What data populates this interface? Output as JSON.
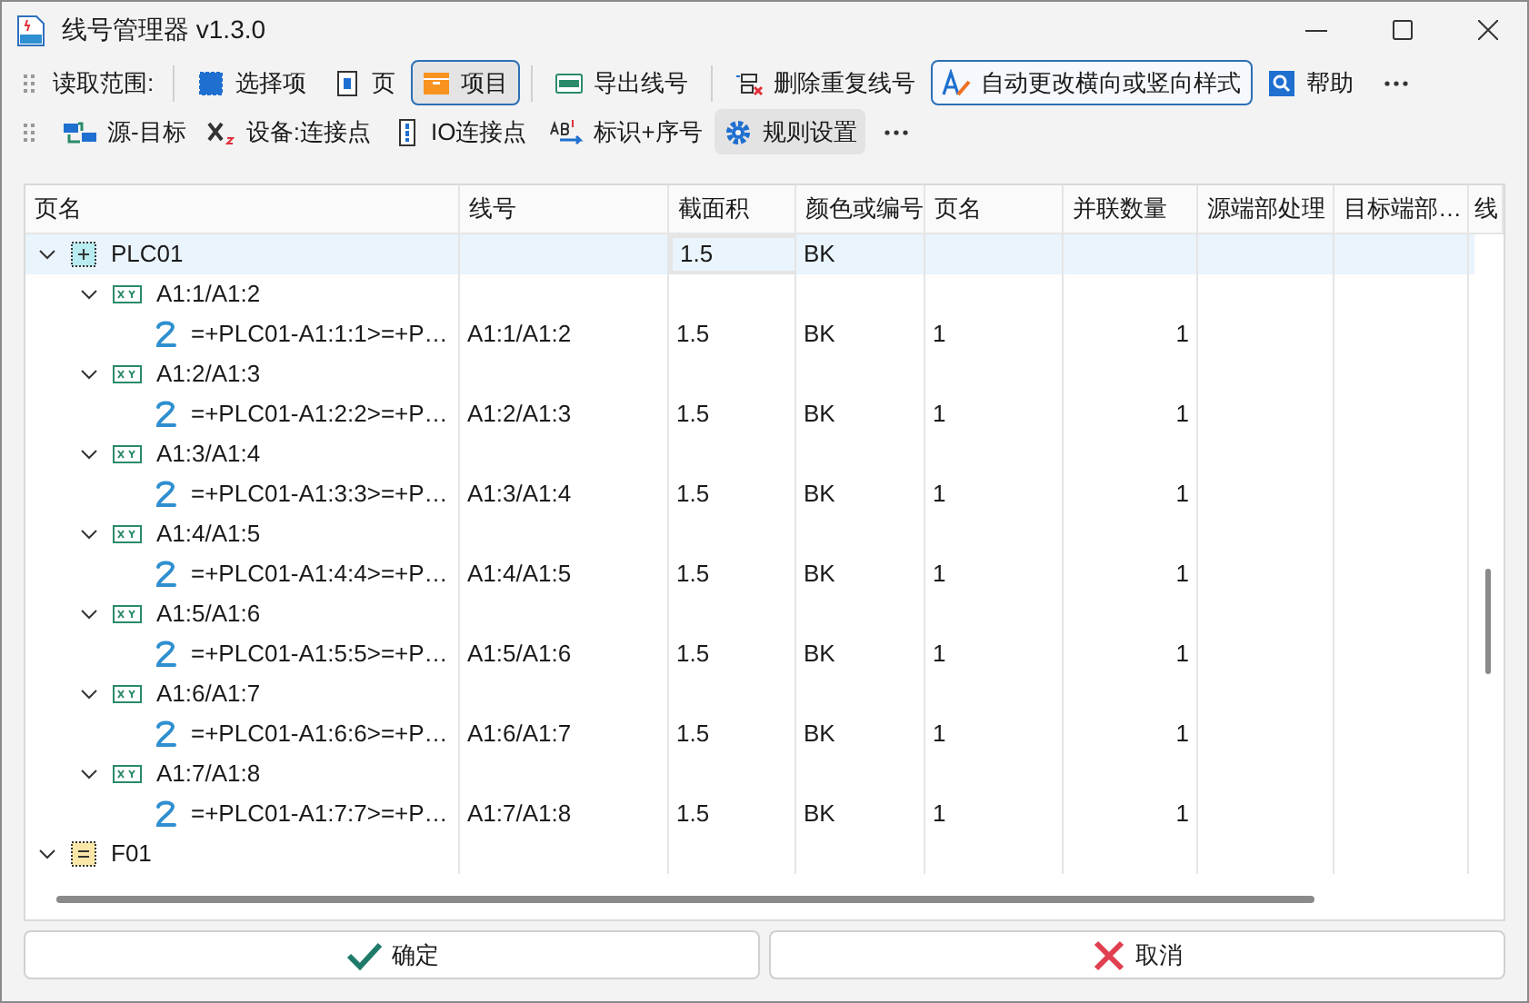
{
  "window": {
    "title": "线号管理器 v1.3.0"
  },
  "toolbar_1": {
    "scope_label": "读取范围:",
    "scope_options": [
      {
        "label": "选择项",
        "kind": "selection",
        "selected": false
      },
      {
        "label": "页",
        "kind": "page",
        "selected": false
      },
      {
        "label": "项目",
        "kind": "project",
        "selected": true
      }
    ],
    "actions": [
      {
        "label": "导出线号",
        "kind": "export",
        "checked": false,
        "divider_before": true
      },
      {
        "label": "删除重复线号",
        "kind": "dedupe",
        "checked": false,
        "divider_before": true
      },
      {
        "label": "自动更改横向或竖向样式",
        "kind": "orientation",
        "checked": true,
        "divider_before": false
      },
      {
        "label": "帮助",
        "kind": "help",
        "checked": false,
        "divider_before": false
      }
    ]
  },
  "toolbar_2": {
    "actions": [
      {
        "label": "源-目标",
        "kind": "source_target",
        "highlighted": false
      },
      {
        "label": "设备:连接点",
        "kind": "device_point",
        "highlighted": false
      },
      {
        "label": "IO连接点",
        "kind": "io_point",
        "highlighted": false
      },
      {
        "label": "标识+序号",
        "kind": "tag_index",
        "highlighted": false
      },
      {
        "label": "规则设置",
        "kind": "settings",
        "highlighted": true
      }
    ]
  },
  "table": {
    "columns": [
      "页名",
      "线号",
      "截面积",
      "颜色或编号",
      "页名",
      "并联数量",
      "源端部处理",
      "目标端部…",
      "线"
    ],
    "rows": [
      {
        "kind": "location",
        "label": "PLC01",
        "expanded": true,
        "selected": true,
        "cross_section_focused": true,
        "cross_section": "1.5",
        "color_code": "BK",
        "children": [
          {
            "kind": "pair",
            "label": "A1:1/A1:2",
            "expanded": true,
            "children": [
              {
                "kind": "wire",
                "label": "=+PLC01-A1:1:1>=+P…",
                "wire_no": "A1:1/A1:2",
                "cross_section": "1.5",
                "color_code": "BK",
                "page": "1",
                "parallel_count": "1"
              }
            ]
          },
          {
            "kind": "pair",
            "label": "A1:2/A1:3",
            "expanded": true,
            "children": [
              {
                "kind": "wire",
                "label": "=+PLC01-A1:2:2>=+P…",
                "wire_no": "A1:2/A1:3",
                "cross_section": "1.5",
                "color_code": "BK",
                "page": "1",
                "parallel_count": "1"
              }
            ]
          },
          {
            "kind": "pair",
            "label": "A1:3/A1:4",
            "expanded": true,
            "children": [
              {
                "kind": "wire",
                "label": "=+PLC01-A1:3:3>=+P…",
                "wire_no": "A1:3/A1:4",
                "cross_section": "1.5",
                "color_code": "BK",
                "page": "1",
                "parallel_count": "1"
              }
            ]
          },
          {
            "kind": "pair",
            "label": "A1:4/A1:5",
            "expanded": true,
            "children": [
              {
                "kind": "wire",
                "label": "=+PLC01-A1:4:4>=+P…",
                "wire_no": "A1:4/A1:5",
                "cross_section": "1.5",
                "color_code": "BK",
                "page": "1",
                "parallel_count": "1"
              }
            ]
          },
          {
            "kind": "pair",
            "label": "A1:5/A1:6",
            "expanded": true,
            "children": [
              {
                "kind": "wire",
                "label": "=+PLC01-A1:5:5>=+P…",
                "wire_no": "A1:5/A1:6",
                "cross_section": "1.5",
                "color_code": "BK",
                "page": "1",
                "parallel_count": "1"
              }
            ]
          },
          {
            "kind": "pair",
            "label": "A1:6/A1:7",
            "expanded": true,
            "children": [
              {
                "kind": "wire",
                "label": "=+PLC01-A1:6:6>=+P…",
                "wire_no": "A1:6/A1:7",
                "cross_section": "1.5",
                "color_code": "BK",
                "page": "1",
                "parallel_count": "1"
              }
            ]
          },
          {
            "kind": "pair",
            "label": "A1:7/A1:8",
            "expanded": true,
            "children": [
              {
                "kind": "wire",
                "label": "=+PLC01-A1:7:7>=+P…",
                "wire_no": "A1:7/A1:8",
                "cross_section": "1.5",
                "color_code": "BK",
                "page": "1",
                "parallel_count": "1"
              }
            ]
          }
        ]
      },
      {
        "kind": "function",
        "label": "F01",
        "expanded": true,
        "selected": false
      }
    ]
  },
  "buttons": [
    {
      "label": "确定",
      "kind": "ok"
    },
    {
      "label": "取消",
      "kind": "cancel"
    }
  ]
}
